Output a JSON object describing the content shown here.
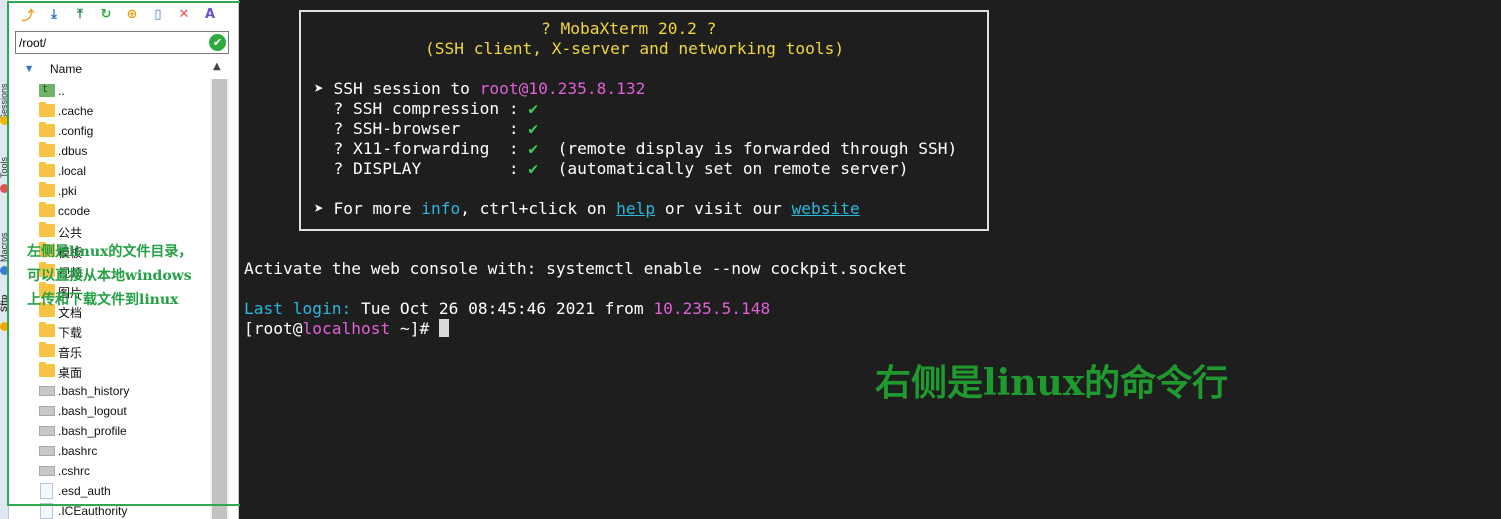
{
  "side_tabs": [
    "Sessions",
    "Tools",
    "Macros",
    "Sftp"
  ],
  "toolbar": {
    "buttons": [
      {
        "name": "parent-folder-icon",
        "glyph": "⤴",
        "color": "#e8a317"
      },
      {
        "name": "download-icon",
        "glyph": "⤓",
        "color": "#2a72c8"
      },
      {
        "name": "upload-icon",
        "glyph": "⤒",
        "color": "#1f8a4f"
      },
      {
        "name": "refresh-icon",
        "glyph": "↻",
        "color": "#2eaa3f"
      },
      {
        "name": "new-folder-icon",
        "glyph": "⊕",
        "color": "#e8a317"
      },
      {
        "name": "new-file-icon",
        "glyph": "▯",
        "color": "#3a7bd5"
      },
      {
        "name": "delete-icon",
        "glyph": "✕",
        "color": "#e05252"
      },
      {
        "name": "rename-icon",
        "glyph": "A",
        "color": "#6a4fcf"
      }
    ]
  },
  "path": {
    "value": "/root/"
  },
  "file_list": {
    "column": "Name",
    "items": [
      {
        "name": "..",
        "type": "up"
      },
      {
        "name": ".cache",
        "type": "folder"
      },
      {
        "name": ".config",
        "type": "folder"
      },
      {
        "name": ".dbus",
        "type": "folder"
      },
      {
        "name": ".local",
        "type": "folder"
      },
      {
        "name": ".pki",
        "type": "folder"
      },
      {
        "name": "ccode",
        "type": "folder"
      },
      {
        "name": "公共",
        "type": "folder"
      },
      {
        "name": "模板",
        "type": "folder"
      },
      {
        "name": "视频",
        "type": "folder"
      },
      {
        "name": "图片",
        "type": "folder"
      },
      {
        "name": "文档",
        "type": "folder"
      },
      {
        "name": "下载",
        "type": "folder"
      },
      {
        "name": "音乐",
        "type": "folder"
      },
      {
        "name": "桌面",
        "type": "folder"
      },
      {
        "name": ".bash_history",
        "type": "file"
      },
      {
        "name": ".bash_logout",
        "type": "file"
      },
      {
        "name": ".bash_profile",
        "type": "file"
      },
      {
        "name": ".bashrc",
        "type": "file"
      },
      {
        "name": ".cshrc",
        "type": "file"
      },
      {
        "name": ".esd_auth",
        "type": "doc"
      },
      {
        "name": ".ICEauthority",
        "type": "doc"
      }
    ]
  },
  "left_annotation": [
    "左侧是linux的文件目录，",
    "可以直接从本地windows",
    "上传和下载文件到linux"
  ],
  "terminal": {
    "banner_title": "? MobaXterm 20.2 ?",
    "banner_subtitle": "(SSH client, X-server and networking tools)",
    "ssh_prefix": "➤ SSH session to ",
    "ssh_user": "root",
    "ssh_host": "@10.235.8.132",
    "options": [
      {
        "label": "  ? SSH compression : ",
        "check": "✔",
        "note": ""
      },
      {
        "label": "  ? SSH-browser     : ",
        "check": "✔",
        "note": ""
      },
      {
        "label": "  ? X11-forwarding  : ",
        "check": "✔",
        "note": "  (remote display is forwarded through SSH)"
      },
      {
        "label": "  ? DISPLAY         : ",
        "check": "✔",
        "note": "  (automatically set on remote server)"
      }
    ],
    "more_prefix": "➤ For more ",
    "more_info": "info",
    "more_mid": ", ctrl+click on ",
    "more_help": "help",
    "more_or": " or visit our ",
    "more_website": "website",
    "activate": "Activate the web console with: systemctl enable --now cockpit.socket",
    "last_login_label": "Last login:",
    "last_login_value": " Tue Oct 26 08:45:46 2021 from ",
    "last_login_ip": "10.235.5.148",
    "prompt_open": "[root@",
    "prompt_host": "localhost",
    "prompt_close": " ~]# "
  },
  "right_annotation": "右侧是linux的命令行"
}
